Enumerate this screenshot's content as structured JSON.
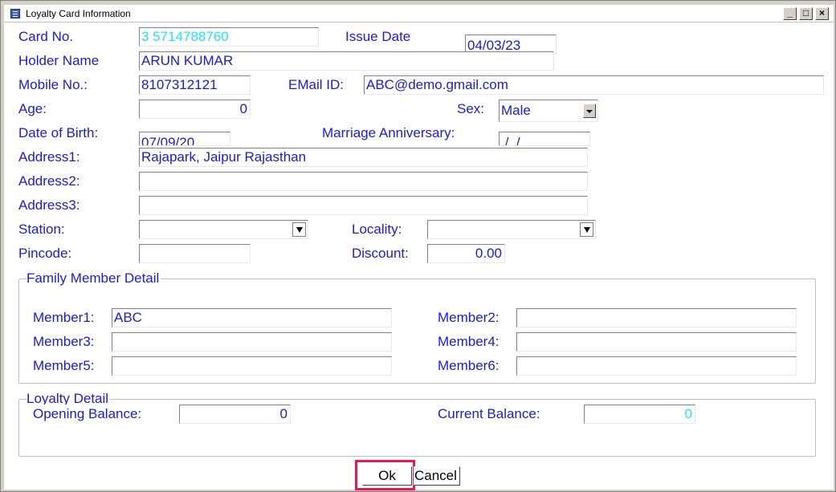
{
  "window": {
    "title": "Loyalty Card Information"
  },
  "labels": {
    "card_no": "Card No.",
    "issue_date": "Issue Date",
    "holder_name": "Holder Name",
    "mobile_no": "Mobile No.:",
    "email_id": "EMail ID:",
    "age": "Age:",
    "sex": "Sex:",
    "dob": "Date of Birth:",
    "anniversary": "Marriage Anniversary:",
    "address1": "Address1:",
    "address2": "Address2:",
    "address3": "Address3:",
    "station": "Station:",
    "locality": "Locality:",
    "pincode": "Pincode:",
    "discount": "Discount:"
  },
  "values": {
    "card_no": "3     5714788760",
    "issue_date": "04/03/23",
    "holder_name": "ARUN KUMAR",
    "mobile_no": "8107312121",
    "email_id": "ABC@demo.gmail.com",
    "age": "0",
    "sex": "Male",
    "dob": "07/09/20",
    "anniversary": " /  /",
    "address1": "Rajapark, Jaipur Rajasthan",
    "address2": "",
    "address3": "",
    "station": "",
    "locality": "",
    "pincode": "",
    "discount": "0.00"
  },
  "family": {
    "title": "Family Member Detail",
    "members": [
      {
        "label": "Member1:",
        "value": "ABC"
      },
      {
        "label": "Member2:",
        "value": ""
      },
      {
        "label": "Member3:",
        "value": ""
      },
      {
        "label": "Member4:",
        "value": ""
      },
      {
        "label": "Member5:",
        "value": ""
      },
      {
        "label": "Member6:",
        "value": ""
      }
    ]
  },
  "loyalty": {
    "title": "Loyalty Detail",
    "opening_label": "Opening Balance:",
    "opening_value": "0",
    "current_label": "Current Balance:",
    "current_value": "0"
  },
  "buttons": {
    "ok": "Ok",
    "cancel": "Cancel"
  },
  "colors": {
    "label_text": "#1a1adc",
    "accent_cyan": "#22e0ff",
    "highlight": "#e8185a"
  }
}
